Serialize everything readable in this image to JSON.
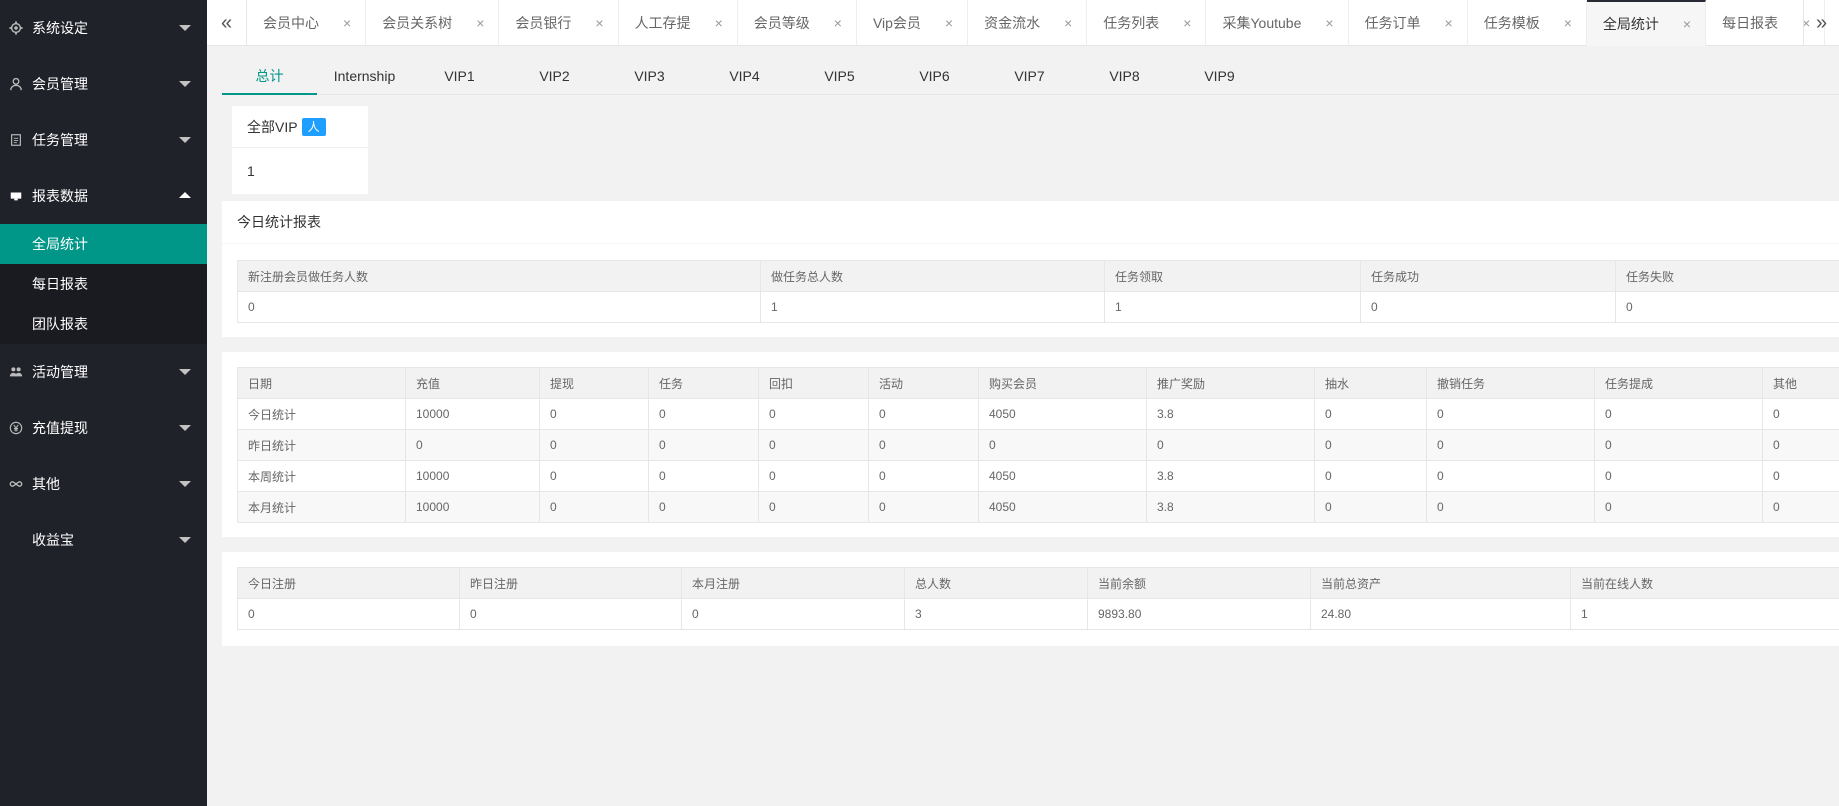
{
  "sidebar": {
    "groups": [
      {
        "label": "系统设定",
        "icon": "gear-icon"
      },
      {
        "label": "会员管理",
        "icon": "user-icon"
      },
      {
        "label": "任务管理",
        "icon": "file-icon"
      },
      {
        "label": "报表数据",
        "icon": "report-icon",
        "items": [
          "全局统计",
          "每日报表",
          "团队报表"
        ]
      },
      {
        "label": "活动管理",
        "icon": "group-icon"
      },
      {
        "label": "充值提现",
        "icon": "yen-icon"
      },
      {
        "label": "其他",
        "icon": "infinity-icon"
      },
      {
        "label": "收益宝",
        "icon": ""
      }
    ]
  },
  "tabs": [
    {
      "label": "会员中心"
    },
    {
      "label": "会员关系树"
    },
    {
      "label": "会员银行"
    },
    {
      "label": "人工存提"
    },
    {
      "label": "会员等级"
    },
    {
      "label": "Vip会员"
    },
    {
      "label": "资金流水"
    },
    {
      "label": "任务列表"
    },
    {
      "label": "采集Youtube"
    },
    {
      "label": "任务订单"
    },
    {
      "label": "任务模板"
    },
    {
      "label": "全局统计"
    },
    {
      "label": "每日报表"
    }
  ],
  "tab_close_glyph": "×",
  "vip_tabs": [
    "总计",
    "Internship",
    "VIP1",
    "VIP2",
    "VIP3",
    "VIP4",
    "VIP5",
    "VIP6",
    "VIP7",
    "VIP8",
    "VIP9"
  ],
  "vip_card": {
    "title": "全部VIP",
    "badge": "人",
    "value": "1"
  },
  "today_report": {
    "title": "今日统计报表",
    "headers": [
      "新注册会员做任务人数",
      "做任务总人数",
      "任务领取",
      "任务成功",
      "任务失败"
    ],
    "row": [
      "0",
      "1",
      "1",
      "0",
      "0"
    ]
  },
  "finance_table": {
    "headers": [
      "日期",
      "充值",
      "提现",
      "任务",
      "回扣",
      "活动",
      "购买会员",
      "推广奖励",
      "抽水",
      "撤销任务",
      "任务提成",
      "其他"
    ],
    "rows": [
      [
        "今日统计",
        "10000",
        "0",
        "0",
        "0",
        "0",
        "4050",
        "3.8",
        "0",
        "0",
        "0",
        "0"
      ],
      [
        "昨日统计",
        "0",
        "0",
        "0",
        "0",
        "0",
        "0",
        "0",
        "0",
        "0",
        "0",
        "0"
      ],
      [
        "本周统计",
        "10000",
        "0",
        "0",
        "0",
        "0",
        "4050",
        "3.8",
        "0",
        "0",
        "0",
        "0"
      ],
      [
        "本月统计",
        "10000",
        "0",
        "0",
        "0",
        "0",
        "4050",
        "3.8",
        "0",
        "0",
        "0",
        "0"
      ]
    ]
  },
  "member_table": {
    "headers": [
      "今日注册",
      "昨日注册",
      "本月注册",
      "总人数",
      "当前余额",
      "当前总资产",
      "当前在线人数"
    ],
    "row": [
      "0",
      "0",
      "0",
      "3",
      "9893.80",
      "24.80",
      "1"
    ]
  },
  "colors": {
    "accent": "#009688",
    "sidebar_bg": "#20222a",
    "badge": "#1E9FFF"
  }
}
